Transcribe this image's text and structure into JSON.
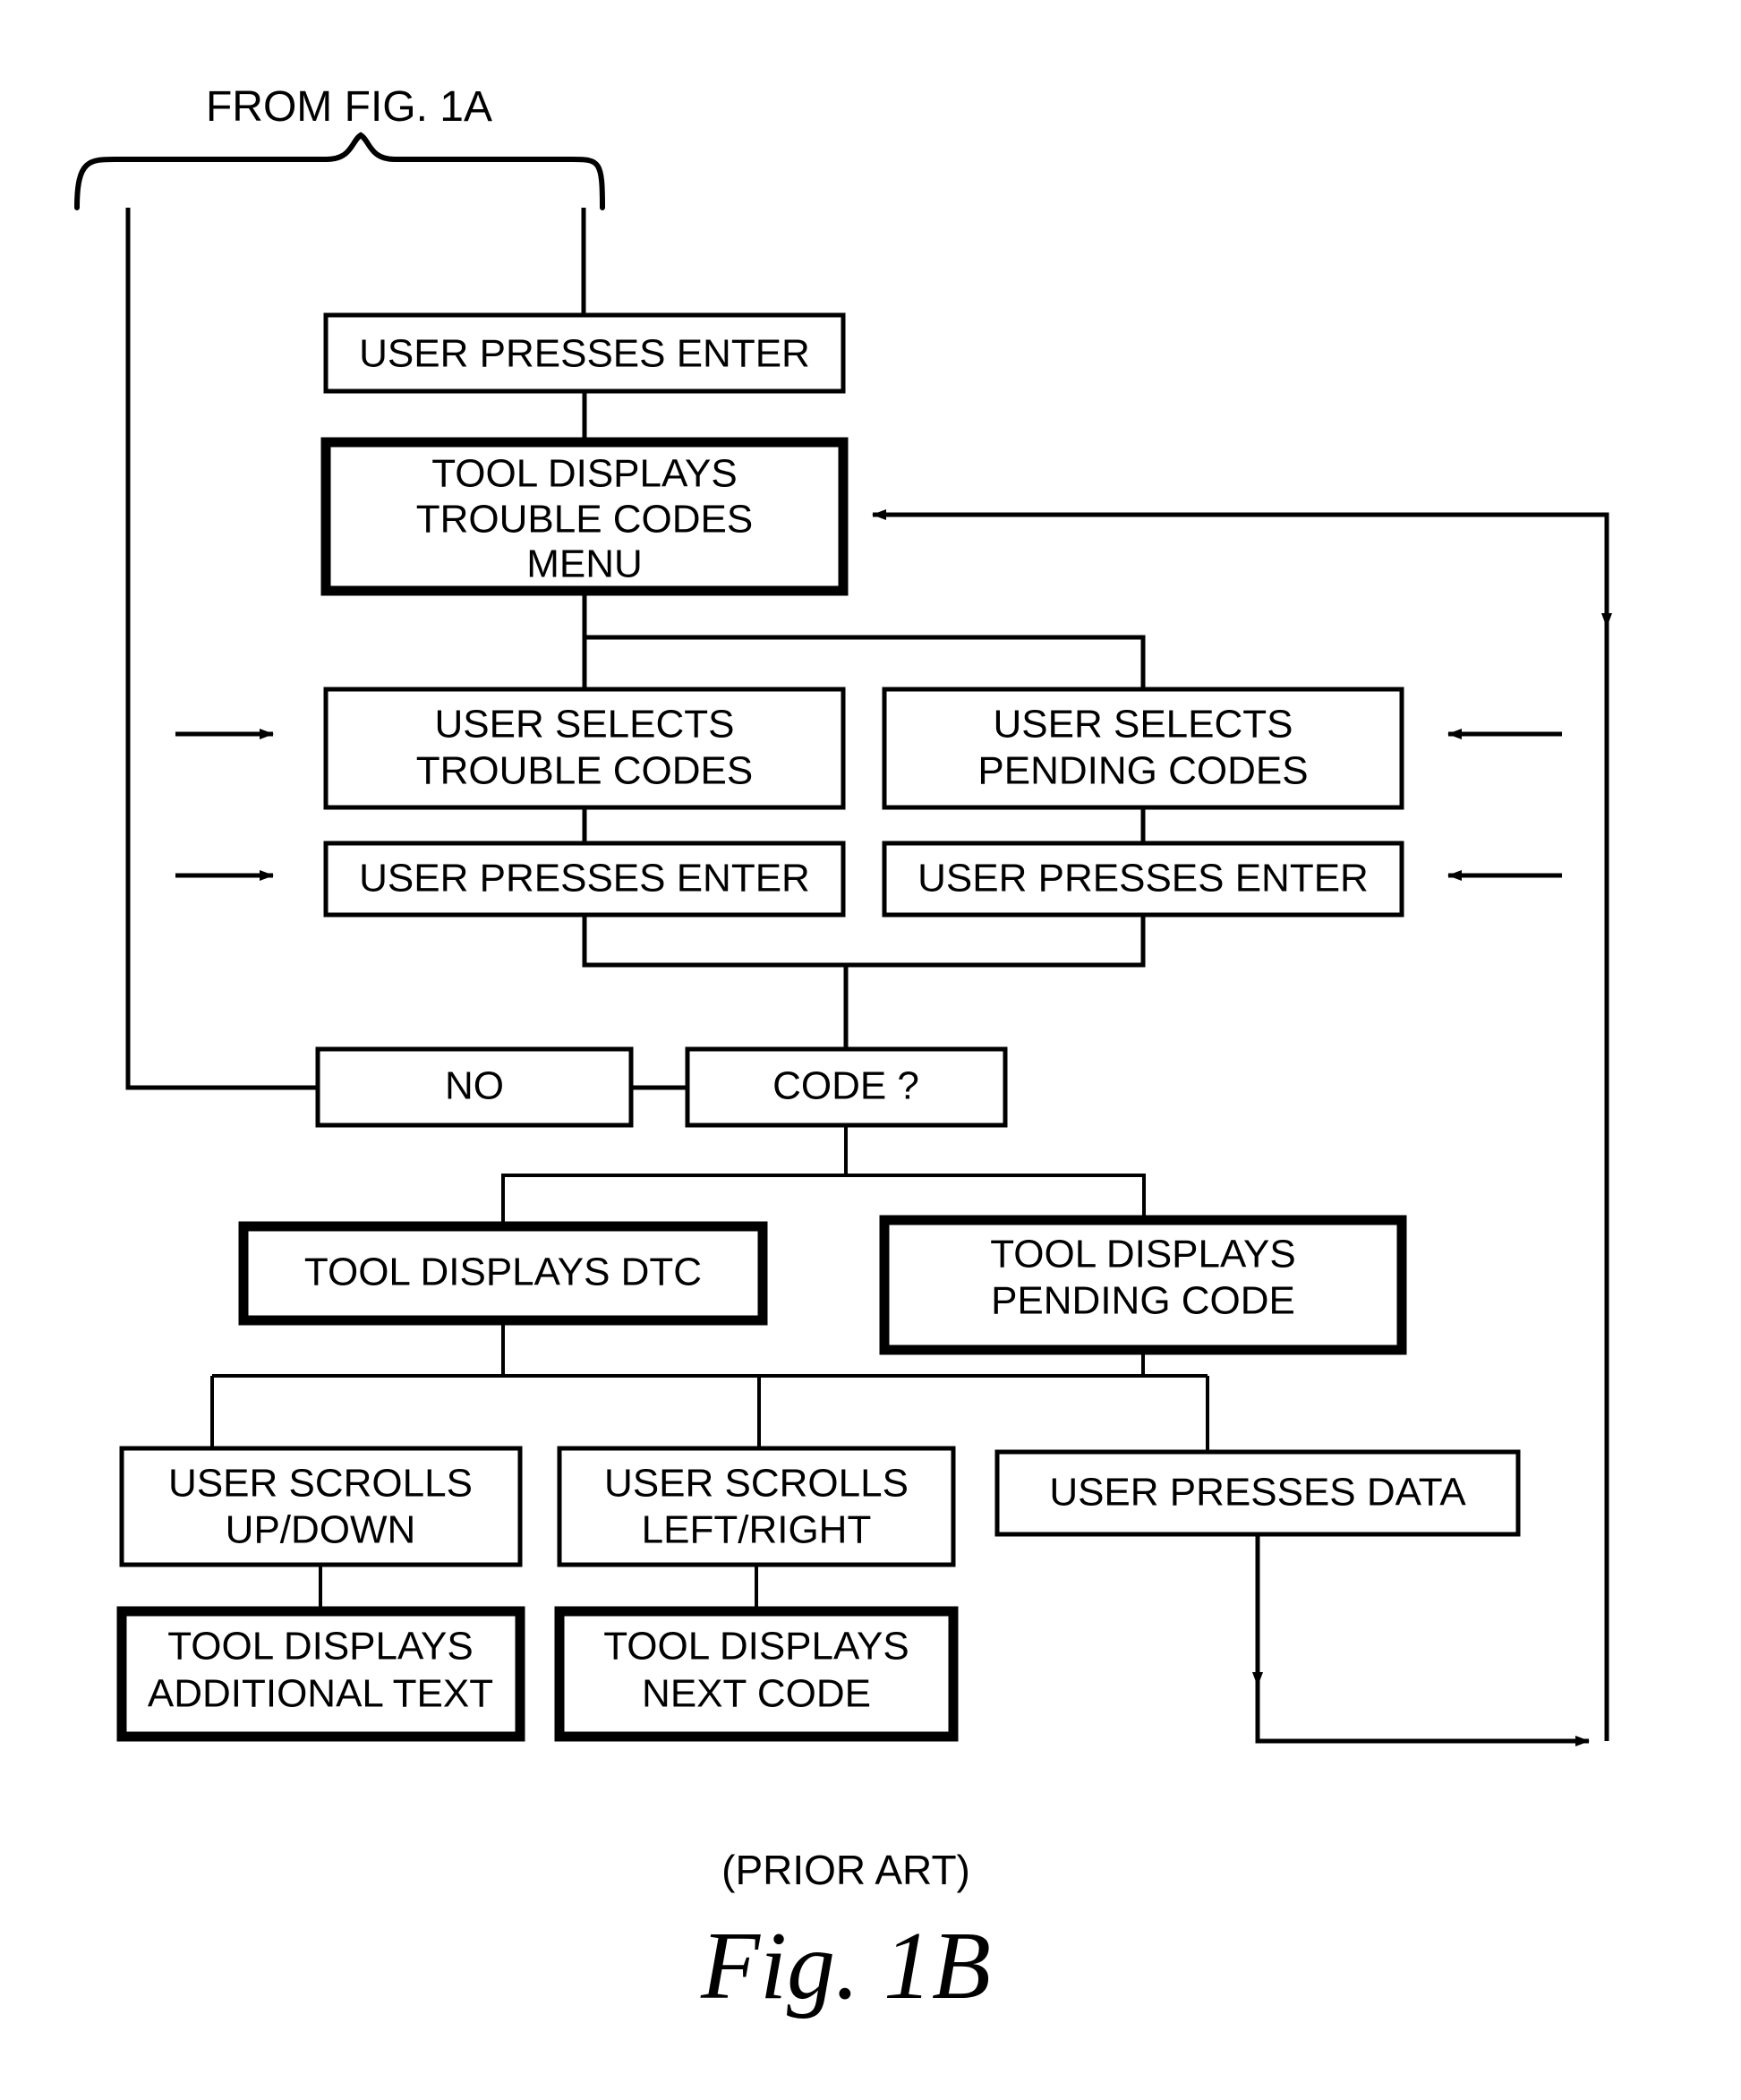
{
  "figure": {
    "source_label": "FROM FIG. 1A",
    "prior_art_note": "(PRIOR ART)",
    "caption": "Fig. 1B"
  },
  "nodes": {
    "user_presses_enter_top": "USER PRESSES ENTER",
    "tool_displays_trouble_codes_menu_l1": "TOOL DISPLAYS",
    "tool_displays_trouble_codes_menu_l2": "TROUBLE CODES",
    "tool_displays_trouble_codes_menu_l3": "MENU",
    "user_selects_trouble_codes_l1": "USER SELECTS",
    "user_selects_trouble_codes_l2": "TROUBLE CODES",
    "user_selects_pending_codes_l1": "USER SELECTS",
    "user_selects_pending_codes_l2": "PENDING CODES",
    "user_presses_enter_left": "USER PRESSES ENTER",
    "user_presses_enter_right": "USER PRESSES ENTER",
    "no_branch": "NO",
    "code_decision": "CODE ?",
    "tool_displays_dtc": "TOOL DISPLAYS DTC",
    "tool_displays_pending_code_l1": "TOOL DISPLAYS",
    "tool_displays_pending_code_l2": "PENDING CODE",
    "user_scrolls_up_down_l1": "USER SCROLLS",
    "user_scrolls_up_down_l2": "UP/DOWN",
    "user_scrolls_left_right_l1": "USER SCROLLS",
    "user_scrolls_left_right_l2": "LEFT/RIGHT",
    "tool_displays_additional_text_l1": "TOOL DISPLAYS",
    "tool_displays_additional_text_l2": "ADDITIONAL TEXT",
    "tool_displays_next_code_l1": "TOOL DISPLAYS",
    "tool_displays_next_code_l2": "NEXT CODE",
    "user_presses_data": "USER PRESSES DATA"
  },
  "colors": {
    "line": "#000000",
    "background": "#ffffff",
    "text": "#000000"
  },
  "chart_data": {
    "type": "diagram",
    "title": "Fig. 1B (PRIOR ART)",
    "diagram_kind": "flowchart",
    "entry": "FROM FIG. 1A",
    "steps": [
      "USER PRESSES ENTER",
      "TOOL DISPLAYS TROUBLE CODES MENU",
      "USER SELECTS TROUBLE CODES",
      "USER SELECTS PENDING CODES",
      "USER PRESSES ENTER",
      "USER PRESSES ENTER",
      "NO",
      "CODE ?",
      "TOOL DISPLAYS DTC",
      "TOOL DISPLAYS PENDING CODE",
      "USER SCROLLS UP/DOWN",
      "USER SCROLLS LEFT/RIGHT",
      "USER PRESSES DATA",
      "TOOL DISPLAYS ADDITIONAL TEXT",
      "TOOL DISPLAYS NEXT CODE"
    ]
  }
}
